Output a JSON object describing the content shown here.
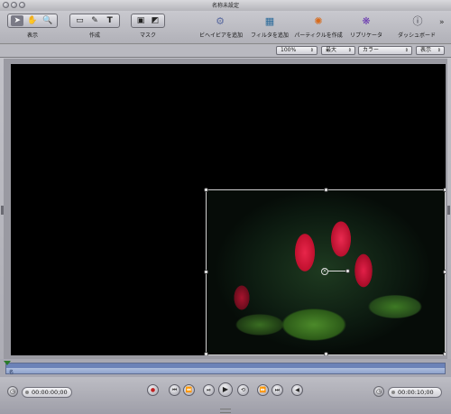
{
  "window": {
    "title": "名称未設定",
    "title_bar_buttons": [
      "close",
      "minimize",
      "zoom"
    ]
  },
  "toolbar": {
    "groups": [
      {
        "label": "表示",
        "icons": [
          "arrow-select-icon",
          "hand-pan-icon",
          "magnifier-zoom-icon"
        ]
      },
      {
        "label": "作成",
        "icons": [
          "rectangle-icon",
          "bezier-pen-icon",
          "text-tool-icon"
        ]
      },
      {
        "label": "マスク",
        "icons": [
          "mask-rect-icon",
          "mask-bezier-icon"
        ]
      }
    ],
    "buttons": [
      {
        "label": "ビヘイビアを追加",
        "icon": "gear-behavior-icon"
      },
      {
        "label": "フィルタを追加",
        "icon": "filter-monitor-icon"
      },
      {
        "label": "パーティクルを作成",
        "icon": "particles-icon"
      },
      {
        "label": "リプリケータ",
        "icon": "replicator-icon"
      },
      {
        "label": "ダッシュボード",
        "icon": "info-dashboard-icon"
      }
    ],
    "overflow_glyph": "»"
  },
  "options": {
    "zoom": "100%",
    "resolution": "最大",
    "channel": "カラー",
    "view": "表示"
  },
  "timeline": {
    "track_label": "名"
  },
  "transport": {
    "current_time": "00:00:00;00",
    "duration": "00:00:10;00",
    "buttons": [
      "record",
      "go-to-start",
      "step-back",
      "play",
      "play-range",
      "loop",
      "step-forward",
      "audio"
    ]
  },
  "colors": {
    "toolbar_bg": "#b9b9c0",
    "canvas_bg": "#000000",
    "selection": "#d0d0d0",
    "timeline_track": "#8fa3cc"
  }
}
